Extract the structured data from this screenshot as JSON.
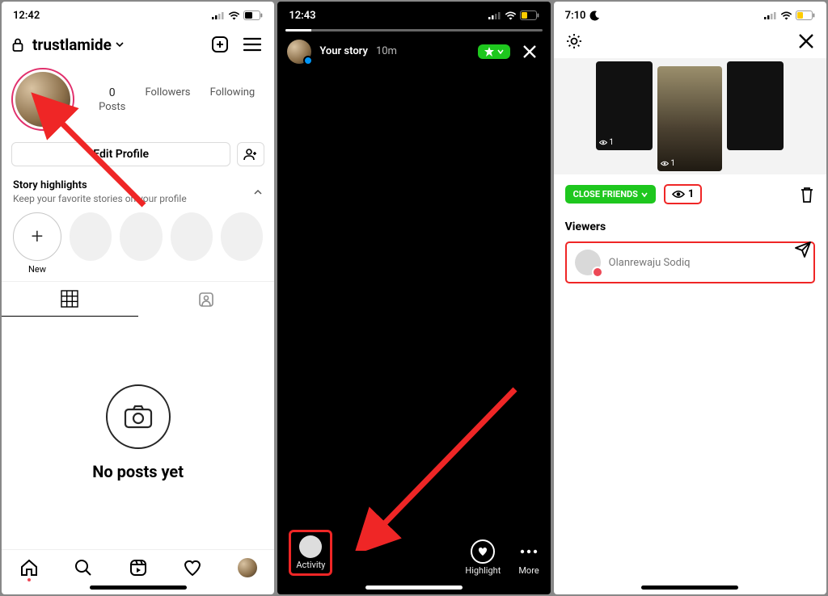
{
  "phone1": {
    "time": "12:42",
    "username": "trustlamide",
    "stats": {
      "posts_count": "0",
      "posts_label": "Posts",
      "followers_label": "Followers",
      "following_label": "Following"
    },
    "edit_profile": "Edit Profile",
    "highlights": {
      "title": "Story highlights",
      "subtitle": "Keep your favorite stories on your profile",
      "new_label": "New"
    },
    "empty_text": "No posts yet"
  },
  "phone2": {
    "time": "12:43",
    "story_label": "Your story",
    "story_time": "10m",
    "footer": {
      "activity": "Activity",
      "highlight": "Highlight",
      "more": "More"
    }
  },
  "phone3": {
    "time": "7:10",
    "thumb_views": [
      "1",
      "1"
    ],
    "close_friends": "CLOSE FRIENDS",
    "view_count": "1",
    "viewers_title": "Viewers",
    "viewer_name": "Olanrewaju Sodiq"
  }
}
